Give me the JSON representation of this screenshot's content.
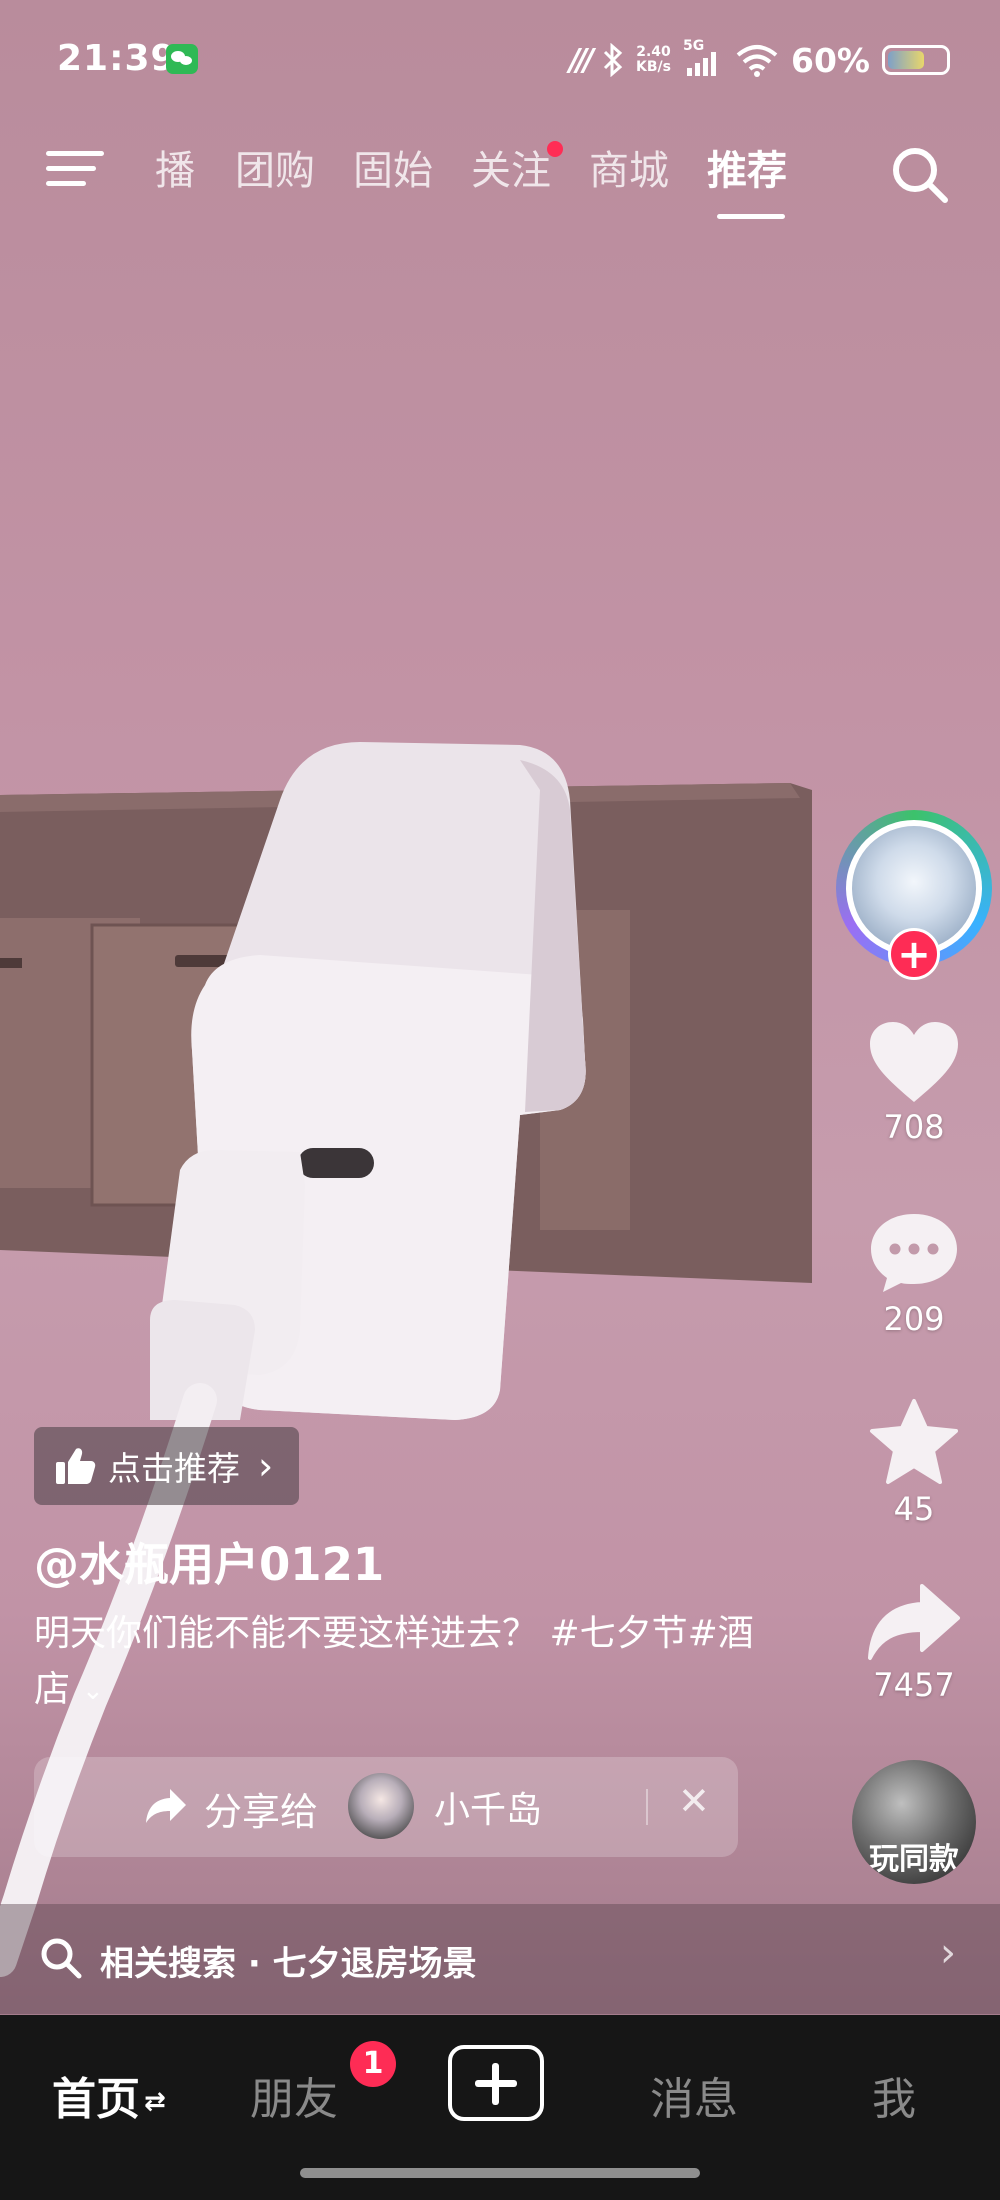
{
  "status_bar": {
    "time": "21:39",
    "net_speed_value": "2.40",
    "net_speed_unit": "KB/s",
    "network": "5G",
    "battery": "60%",
    "icons": [
      "wechat-icon",
      "carrier-icon",
      "bluetooth-icon",
      "signal-icon",
      "wifi-icon",
      "battery-icon"
    ]
  },
  "top_nav": {
    "tabs": [
      {
        "label": "播",
        "partial": true
      },
      {
        "label": "团购"
      },
      {
        "label": "固始"
      },
      {
        "label": "关注",
        "dot": true
      },
      {
        "label": "商城"
      },
      {
        "label": "推荐",
        "active": true
      }
    ]
  },
  "rail": {
    "like_count": "708",
    "comment_count": "209",
    "favorite_count": "45",
    "share_count": "7457",
    "same_style_label": "玩同款",
    "follow_symbol": "+"
  },
  "video_info": {
    "recommend_label": "点击推荐",
    "author": "@水瓶用户0121",
    "caption": "明天你们能不能不要这样进去？ #七夕节#酒店",
    "expand_symbol": "⌄"
  },
  "share_bar": {
    "label": "分享给",
    "contact": "小千岛",
    "close_symbol": "✕"
  },
  "related_search": {
    "text": "相关搜索 · 七夕退房场景",
    "chevron": "›"
  },
  "bottom_nav": {
    "home": "首页",
    "home_suffix": "⇄",
    "friends": "朋友",
    "friends_badge": "1",
    "messages": "消息",
    "me": "我"
  },
  "colors": {
    "accent": "#fe2c55",
    "wall": "#c293a5",
    "nav_bg": "#161616"
  }
}
